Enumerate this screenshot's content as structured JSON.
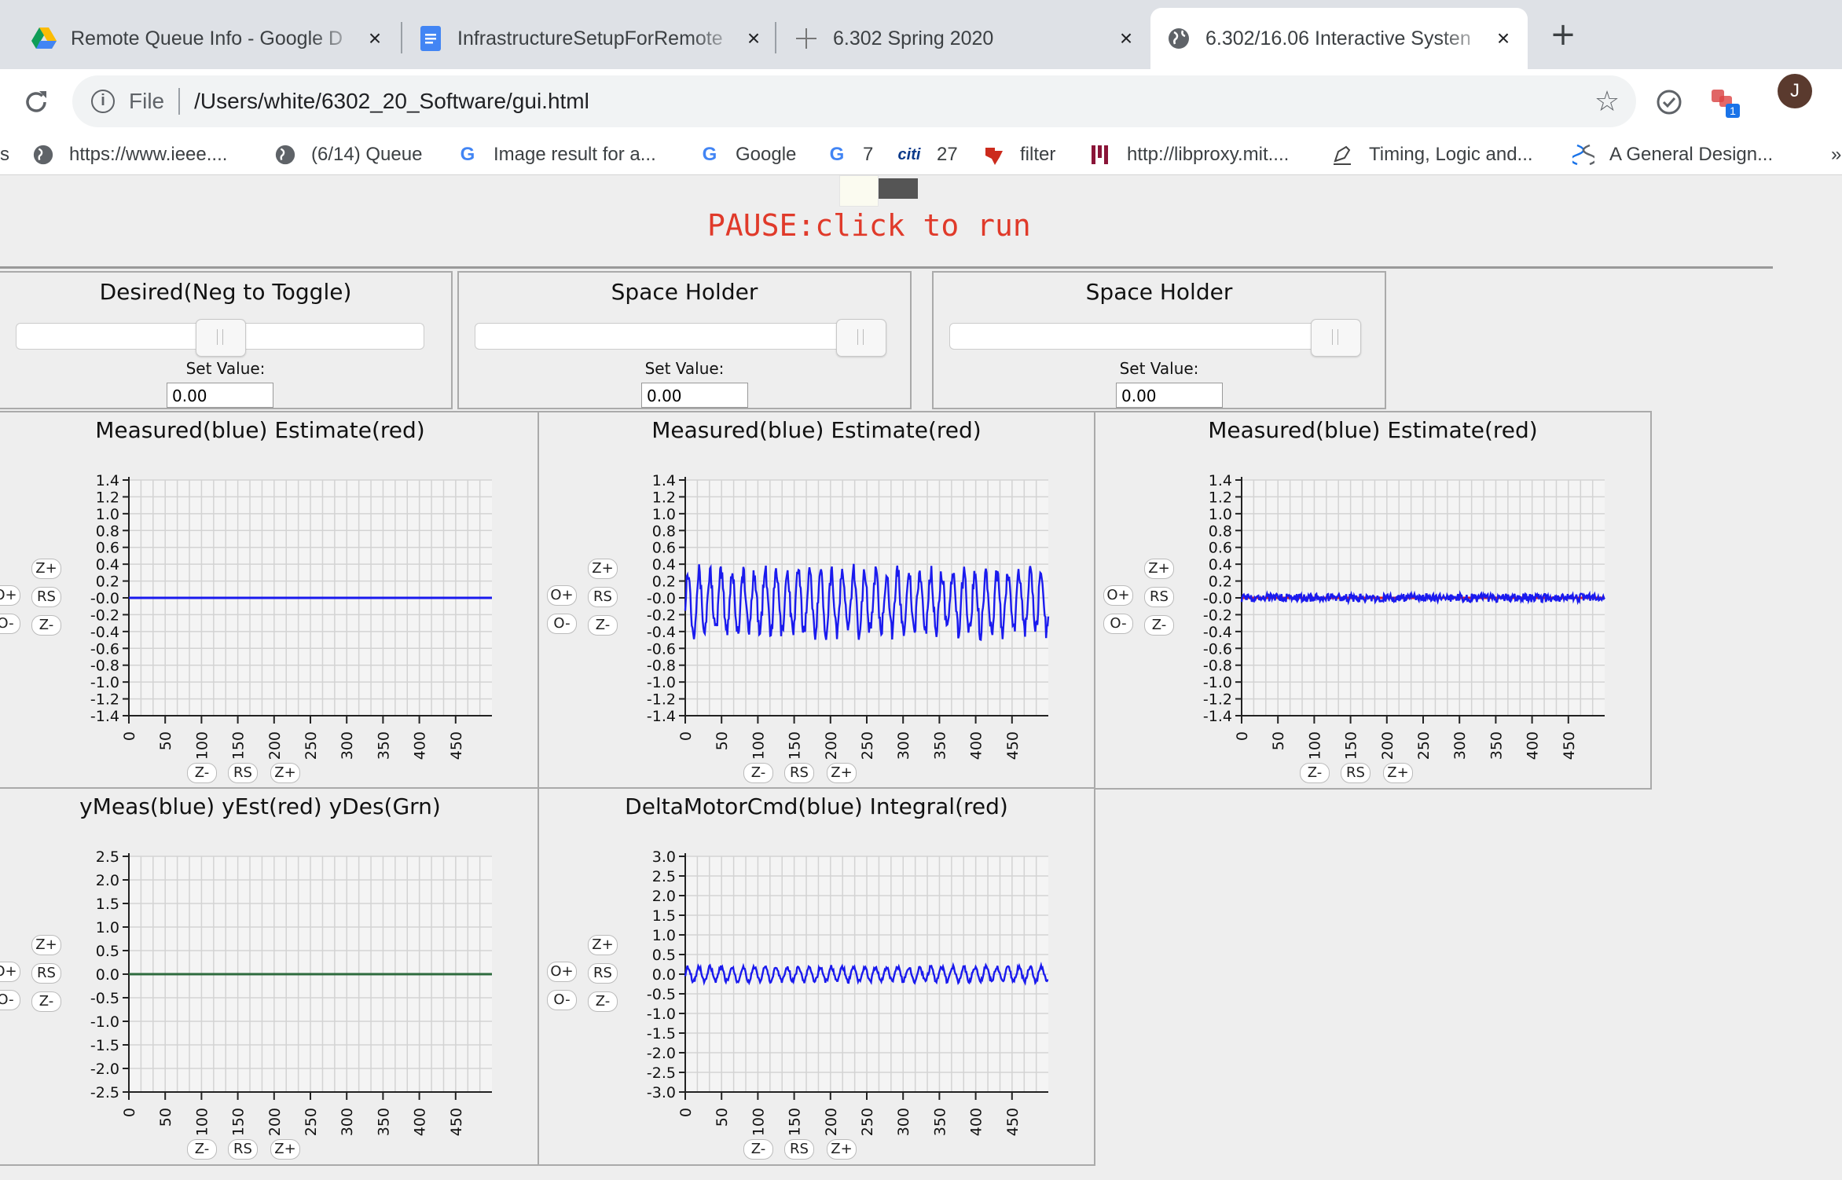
{
  "tabs": [
    {
      "title": "Remote Queue Info - Google D",
      "favicon": "google-drive-icon",
      "active": false
    },
    {
      "title": "InfrastructureSetupForRemote",
      "favicon": "google-docs-icon",
      "active": false
    },
    {
      "title": "6.302 Spring 2020",
      "favicon": "crosshair-icon",
      "active": false
    },
    {
      "title": "6.302/16.06 Interactive Systen",
      "favicon": "globe-icon",
      "active": true
    }
  ],
  "new_tab_label": "+",
  "close_label": "×",
  "address": {
    "scheme": "File",
    "path": "/Users/white/6302_20_Software/gui.html"
  },
  "extension_badge": "1",
  "avatar_letter": "J",
  "bookmarks": [
    {
      "label": "https://www.ieee....",
      "icon": "globe-icon"
    },
    {
      "label": "(6/14) Queue",
      "icon": "globe-icon"
    },
    {
      "label": "Image result for a...",
      "icon": "google-icon"
    },
    {
      "label": "Google",
      "icon": "google-icon"
    },
    {
      "label": "7",
      "icon": "google-icon"
    },
    {
      "label": "27",
      "icon": "citi-icon"
    },
    {
      "label": "filter",
      "icon": "ti-icon"
    },
    {
      "label": "http://libproxy.mit....",
      "icon": "libproxy-icon"
    },
    {
      "label": "Timing, Logic and...",
      "icon": "pen-icon"
    },
    {
      "label": "A General Design...",
      "icon": "dna-icon"
    }
  ],
  "bookmarks_overflow": "»",
  "page": {
    "pause_text": "PAUSE:click to run",
    "sliders": [
      {
        "title": "Desired(Neg to Toggle)",
        "set_label": "Set Value:",
        "value": "0.00",
        "knob_fraction": 0.5
      },
      {
        "title": "Space Holder",
        "set_label": "Set Value:",
        "value": "0.00",
        "knob_fraction": 1.0
      },
      {
        "title": "Space Holder",
        "set_label": "Set Value:",
        "value": "0.00",
        "knob_fraction": 1.0
      }
    ],
    "plot_buttons": {
      "o_plus": "O+",
      "o_minus": "O-",
      "z_plus": "Z+",
      "rs": "RS",
      "z_minus": "Z-"
    }
  },
  "chart_data": [
    {
      "type": "line",
      "title": "Measured(blue) Estimate(red)",
      "xlim": [
        0,
        500
      ],
      "ylim": [
        -1.4,
        1.4
      ],
      "yticks": [
        "1.4",
        "1.2",
        "1.0",
        "0.8",
        "0.6",
        "0.4",
        "0.2",
        "-0.0",
        "-0.2",
        "-0.4",
        "-0.6",
        "-0.8",
        "-1.0",
        "-1.2",
        "-1.4"
      ],
      "xticks": [
        "0",
        "50",
        "100",
        "150",
        "200",
        "250",
        "300",
        "350",
        "400",
        "450"
      ],
      "series": [
        {
          "color": "#1a1aee",
          "pattern": "flat",
          "level": 0.0,
          "amplitude": 0
        }
      ]
    },
    {
      "type": "line",
      "title": "Measured(blue) Estimate(red)",
      "xlim": [
        0,
        500
      ],
      "ylim": [
        -1.4,
        1.4
      ],
      "yticks": [
        "1.4",
        "1.2",
        "1.0",
        "0.8",
        "0.6",
        "0.4",
        "0.2",
        "-0.0",
        "-0.2",
        "-0.4",
        "-0.6",
        "-0.8",
        "-1.0",
        "-1.2",
        "-1.4"
      ],
      "xticks": [
        "0",
        "50",
        "100",
        "150",
        "200",
        "250",
        "300",
        "350",
        "400",
        "450"
      ],
      "series": [
        {
          "color": "#1a1aee",
          "pattern": "oscillation",
          "level": -0.05,
          "amplitude": 0.35
        }
      ]
    },
    {
      "type": "line",
      "title": "Measured(blue) Estimate(red)",
      "xlim": [
        0,
        500
      ],
      "ylim": [
        -1.4,
        1.4
      ],
      "yticks": [
        "1.4",
        "1.2",
        "1.0",
        "0.8",
        "0.6",
        "0.4",
        "0.2",
        "-0.0",
        "-0.2",
        "-0.4",
        "-0.6",
        "-0.8",
        "-1.0",
        "-1.2",
        "-1.4"
      ],
      "xticks": [
        "0",
        "50",
        "100",
        "150",
        "200",
        "250",
        "300",
        "350",
        "400",
        "450"
      ],
      "series": [
        {
          "color": "#e02020",
          "pattern": "flat",
          "level": 0.0,
          "amplitude": 0
        },
        {
          "color": "#1a1aee",
          "pattern": "noise",
          "level": 0.0,
          "amplitude": 0.1
        }
      ]
    },
    {
      "type": "line",
      "title": "yMeas(blue) yEst(red) yDes(Grn)",
      "xlim": [
        0,
        500
      ],
      "ylim": [
        -2.5,
        2.5
      ],
      "yticks": [
        "2.5",
        "2.0",
        "1.5",
        "1.0",
        "0.5",
        "0.0",
        "-0.5",
        "-1.0",
        "-1.5",
        "-2.0",
        "-2.5"
      ],
      "xticks": [
        "0",
        "50",
        "100",
        "150",
        "200",
        "250",
        "300",
        "350",
        "400",
        "450"
      ],
      "series": [
        {
          "color": "#2e6b3e",
          "pattern": "flat",
          "level": 0.0,
          "amplitude": 0
        }
      ]
    },
    {
      "type": "line",
      "title": "DeltaMotorCmd(blue) Integral(red)",
      "xlim": [
        0,
        500
      ],
      "ylim": [
        -3.0,
        3.0
      ],
      "yticks": [
        "3.0",
        "2.5",
        "2.0",
        "1.5",
        "1.0",
        "0.5",
        "0.0",
        "-0.5",
        "-1.0",
        "-1.5",
        "-2.0",
        "-2.5",
        "-3.0"
      ],
      "xticks": [
        "0",
        "50",
        "100",
        "150",
        "200",
        "250",
        "300",
        "350",
        "400",
        "450"
      ],
      "series": [
        {
          "color": "#1a1aee",
          "pattern": "oscillation",
          "level": 0.0,
          "amplitude": 0.18
        }
      ]
    }
  ]
}
